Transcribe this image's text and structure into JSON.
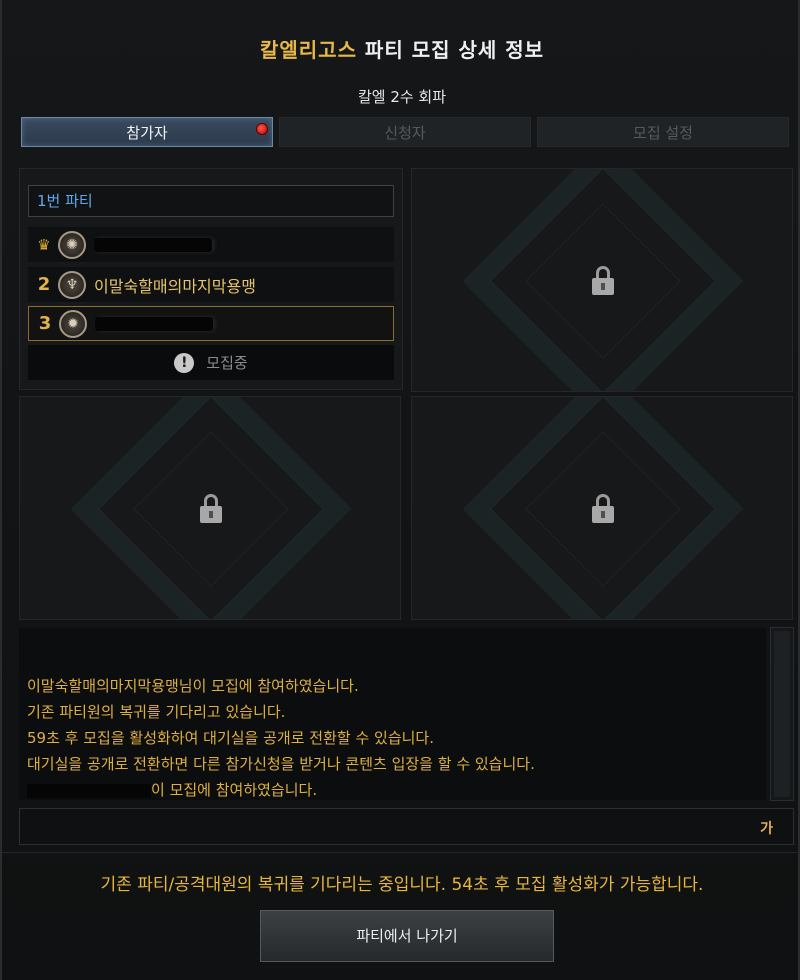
{
  "window": {
    "title_highlight": "칼엘리고스",
    "title_rest": " 파티 모집 상세 정보",
    "subtitle": "칼엘 2수 회파"
  },
  "tabs": [
    {
      "label": "참가자",
      "active": true,
      "has_alert": true
    },
    {
      "label": "신청자",
      "active": false
    },
    {
      "label": "모집 설정",
      "active": false
    }
  ],
  "party": {
    "header": "1번 파티",
    "members": [
      {
        "slot": "leader",
        "icon": "crown-icon",
        "class_icon": "class-emblem-icon",
        "name_redacted": true
      },
      {
        "slot": "2",
        "class_icon": "bard-lyre-icon",
        "name": "이말숙할매의마지막용맹"
      },
      {
        "slot": "3",
        "class_icon": "compass-star-icon",
        "name_redacted": true,
        "selected": true
      }
    ],
    "recruit_status": "모집중"
  },
  "locked_slots": [
    "lock-icon",
    "lock-icon",
    "lock-icon"
  ],
  "chat": {
    "lines": [
      "이말숙할매의마지막용맹님이 모집에 참여하였습니다.",
      "기존 파티원의 복귀를 기다리고 있습니다.",
      "59초 후 모집을 활성화하여 대기실을 공개로 전환할 수 있습니다.",
      "대기실을 공개로 전환하면 다른 참가신청을 받거나 콘텐츠 입장을 할 수 있습니다."
    ],
    "last_line_suffix": "이 모집에 참여하였습니다.",
    "input_ime_label": "가",
    "text_color": "#ddb03f"
  },
  "status_message": "기존 파티/공격대원의 복귀를 기다리는 중입니다. 54초 후 모집 활성화가 가능합니다.",
  "leave_button": "파티에서 나가기",
  "colors": {
    "accent_gold": "#e8b94a",
    "party_header_blue": "#5fa8f0",
    "alert_red": "#e02020"
  }
}
